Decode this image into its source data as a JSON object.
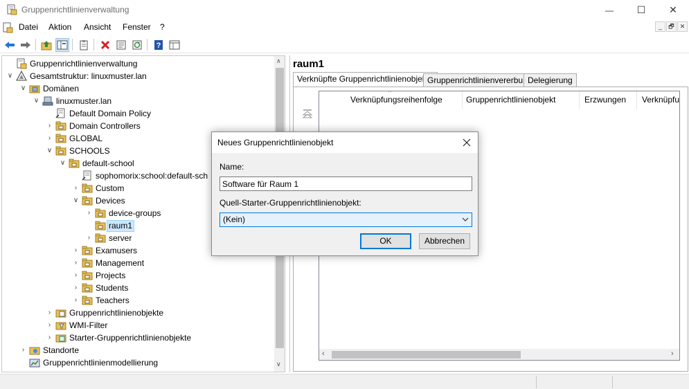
{
  "window": {
    "title": "Gruppenrichtlinienverwaltung",
    "controls": {
      "minimize": "—",
      "maximize": "☐",
      "close": "✕"
    }
  },
  "menu": {
    "items": [
      "Datei",
      "Aktion",
      "Ansicht",
      "Fenster",
      "?"
    ],
    "mdi_controls": [
      "_",
      "🗗",
      "✕"
    ]
  },
  "toolbar": {
    "icons": [
      "back-arrow-icon",
      "forward-arrow-icon",
      "up-folder-icon",
      "show-hide-tree-icon",
      "clipboard-icon",
      "delete-icon",
      "properties-icon",
      "refresh-icon",
      "help-icon",
      "details-view-icon"
    ]
  },
  "tree": {
    "items": [
      {
        "label": "Gruppenrichtlinienverwaltung",
        "level": 0,
        "expander": "",
        "icon": "gpmc-icon"
      },
      {
        "label": "Gesamtstruktur: linuxmuster.lan",
        "level": 0,
        "expander": "∨",
        "icon": "forest-icon"
      },
      {
        "label": "Domänen",
        "level": 1,
        "expander": "∨",
        "icon": "domains-icon"
      },
      {
        "label": "linuxmuster.lan",
        "level": 2,
        "expander": "∨",
        "icon": "domain-icon"
      },
      {
        "label": "Default Domain Policy",
        "level": 3,
        "expander": "",
        "icon": "gpo-link-icon"
      },
      {
        "label": "Domain Controllers",
        "level": 3,
        "expander": "›",
        "icon": "ou-icon"
      },
      {
        "label": "GLOBAL",
        "level": 3,
        "expander": "›",
        "icon": "ou-icon"
      },
      {
        "label": "SCHOOLS",
        "level": 3,
        "expander": "∨",
        "icon": "ou-icon"
      },
      {
        "label": "default-school",
        "level": 4,
        "expander": "∨",
        "icon": "ou-icon"
      },
      {
        "label": "sophomorix:school:default-sch",
        "level": 5,
        "expander": "",
        "icon": "gpo-link-icon"
      },
      {
        "label": "Custom",
        "level": 5,
        "expander": "›",
        "icon": "ou-icon"
      },
      {
        "label": "Devices",
        "level": 5,
        "expander": "∨",
        "icon": "ou-icon"
      },
      {
        "label": "device-groups",
        "level": 6,
        "expander": "›",
        "icon": "ou-icon"
      },
      {
        "label": "raum1",
        "level": 6,
        "expander": "",
        "icon": "ou-icon",
        "selected": true
      },
      {
        "label": "server",
        "level": 6,
        "expander": "›",
        "icon": "ou-icon"
      },
      {
        "label": "Examusers",
        "level": 5,
        "expander": "›",
        "icon": "ou-icon"
      },
      {
        "label": "Management",
        "level": 5,
        "expander": "›",
        "icon": "ou-icon"
      },
      {
        "label": "Projects",
        "level": 5,
        "expander": "›",
        "icon": "ou-icon"
      },
      {
        "label": "Students",
        "level": 5,
        "expander": "›",
        "icon": "ou-icon"
      },
      {
        "label": "Teachers",
        "level": 5,
        "expander": "›",
        "icon": "ou-icon"
      },
      {
        "label": "Gruppenrichtlinienobjekte",
        "level": 3,
        "expander": "›",
        "icon": "gpo-container-icon"
      },
      {
        "label": "WMI-Filter",
        "level": 3,
        "expander": "›",
        "icon": "wmi-filter-icon"
      },
      {
        "label": "Starter-Gruppenrichtlinienobjekte",
        "level": 3,
        "expander": "›",
        "icon": "starter-gpo-icon"
      },
      {
        "label": "Standorte",
        "level": 1,
        "expander": "›",
        "icon": "sites-icon"
      },
      {
        "label": "Gruppenrichtlinienmodellierung",
        "level": 1,
        "expander": "",
        "icon": "modeling-icon"
      }
    ]
  },
  "right_pane": {
    "title": "raum1",
    "tabs": [
      "Verknüpfte Gruppenrichtlinienobjekte",
      "Gruppenrichtlinienvererbung",
      "Delegierung"
    ],
    "active_tab": 0,
    "columns": [
      "Verknüpfungsreihenfolge",
      "Gruppenrichtlinienobjekt",
      "Erzwungen",
      "Verknüpfun"
    ]
  },
  "dialog": {
    "title": "Neues Gruppenrichtlinienobjekt",
    "name_label": "Name:",
    "name_value": "Software für Raum 1",
    "source_label": "Quell-Starter-Gruppenrichtlinienobjekt:",
    "source_value": "(Kein)",
    "ok_label": "OK",
    "cancel_label": "Abbrechen"
  },
  "colors": {
    "folder": "#e8c15c",
    "selection": "#cce8ff",
    "accent": "#0078d7"
  }
}
